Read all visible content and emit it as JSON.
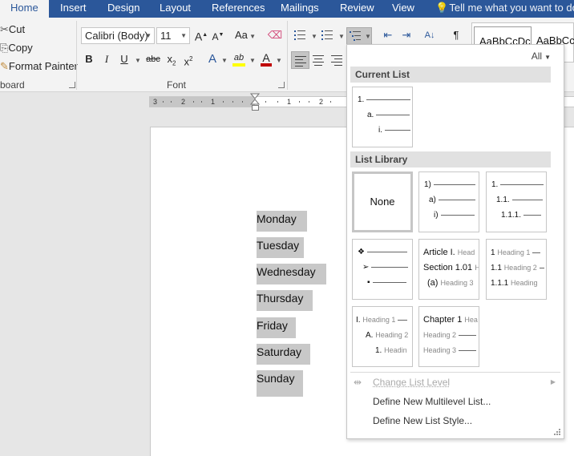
{
  "ribbon_tabs": [
    {
      "label": "Home",
      "active": true
    },
    {
      "label": "Insert"
    },
    {
      "label": "Design"
    },
    {
      "label": "Layout"
    },
    {
      "label": "References"
    },
    {
      "label": "Mailings"
    },
    {
      "label": "Review"
    },
    {
      "label": "View"
    }
  ],
  "tell_me": "Tell me what you want to do",
  "clipboard": {
    "cut": "Cut",
    "copy": "Copy",
    "format_painter": "Format Painter",
    "group_label": "board"
  },
  "font": {
    "name": "Calibri (Body)",
    "size": "11",
    "group_label": "Font",
    "grow": "A",
    "shrink": "A",
    "change_case": "Aa",
    "bold": "B",
    "italic": "I",
    "underline": "U",
    "strikethrough": "abc",
    "subscript": "x",
    "subscript_suffix": "2",
    "superscript": "x",
    "superscript_suffix": "2",
    "text_effects": "A",
    "highlight": "ab",
    "font_color": "A",
    "highlight_color": "#ffff00",
    "font_color_value": "#c00000"
  },
  "styles": {
    "samples": [
      "AaBbCcDc",
      "AaBbCcDc"
    ]
  },
  "ruler": {
    "labels": [
      "3",
      "2",
      "1",
      "1",
      "2"
    ]
  },
  "document": {
    "days": [
      "Monday",
      "Tuesday",
      "Wednesday",
      "Thursday",
      "Friday",
      "Saturday",
      "Sunday"
    ]
  },
  "gallery": {
    "filter": "All",
    "current_list_header": "Current List",
    "list_library_header": "List Library",
    "current": {
      "l1": "1.",
      "l2": "a.",
      "l3": "i."
    },
    "none_label": "None",
    "tile2": {
      "l1": "1)",
      "l2": "a)",
      "l3": "i)"
    },
    "tile3": {
      "l1": "1.",
      "l2": "1.1.",
      "l3": "1.1.1."
    },
    "tile4": {
      "l1": "❖",
      "l2": "➢",
      "l3": "▪"
    },
    "tile5": {
      "l1": "Article I.",
      "l1h": "Head",
      "l2": "Section 1.01",
      "l2h": "H",
      "l3": "(a)",
      "l3h": "Heading 3"
    },
    "tile6": {
      "l1": "1",
      "l1h": "Heading 1",
      "l2": "1.1",
      "l2h": "Heading 2",
      "l3": "1.1.1",
      "l3h": "Heading"
    },
    "tile7": {
      "l1": "I.",
      "l1h": "Heading 1",
      "l2": "A.",
      "l2h": "Heading 2",
      "l3": "1.",
      "l3h": "Headin"
    },
    "tile8": {
      "l1": "Chapter 1",
      "l1h": "Hea",
      "l2h": "Heading 2",
      "l3h": "Heading 3"
    },
    "menu": {
      "change_level": "Change List Level",
      "define_multilevel": "Define New Multilevel List...",
      "define_style": "Define New List Style..."
    }
  }
}
